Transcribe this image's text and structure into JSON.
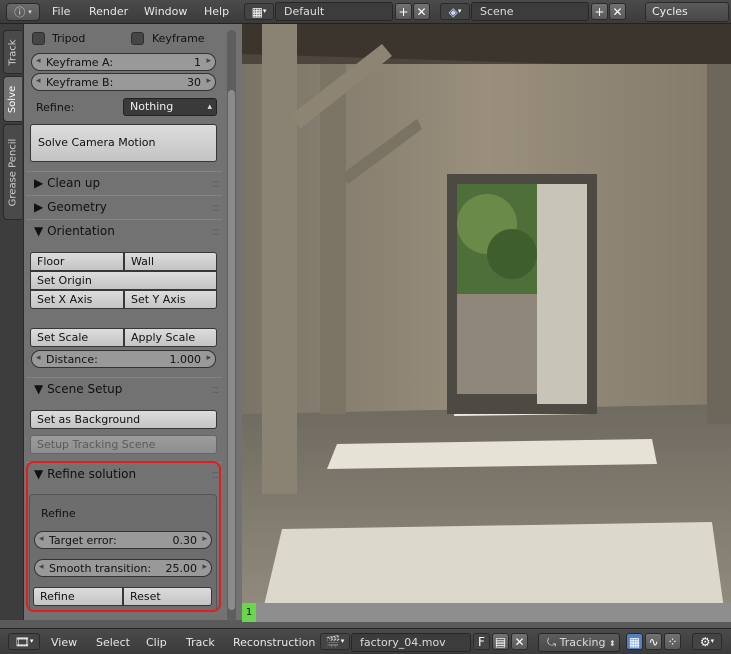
{
  "header": {
    "menus": [
      "File",
      "Render",
      "Window",
      "Help"
    ],
    "screen_layout": "Default",
    "scene": "Scene",
    "render_engine": "Cycles Render"
  },
  "side_tabs": [
    "Track",
    "Solve",
    "Grease Pencil"
  ],
  "solve": {
    "tripod_label": "Tripod",
    "keyframe_label": "Keyframe",
    "keyframe_a_label": "Keyframe A:",
    "keyframe_a_value": "1",
    "keyframe_b_label": "Keyframe B:",
    "keyframe_b_value": "30",
    "refine_label": "Refine:",
    "refine_value": "Nothing",
    "solve_button": "Solve Camera Motion"
  },
  "panels": {
    "clean_up": "Clean up",
    "geometry": "Geometry",
    "orientation": "Orientation",
    "scene_setup": "Scene Setup",
    "refine_solution": "Refine solution"
  },
  "orientation": {
    "floor": "Floor",
    "wall": "Wall",
    "set_origin": "Set Origin",
    "set_x_axis": "Set X Axis",
    "set_y_axis": "Set Y Axis",
    "set_scale": "Set Scale",
    "apply_scale": "Apply Scale",
    "distance_label": "Distance:",
    "distance_value": "1.000"
  },
  "scene_setup": {
    "set_as_background": "Set as Background",
    "setup_tracking_scene": "Setup Tracking Scene"
  },
  "refine_solution": {
    "refine_title": "Refine",
    "target_error_label": "Target error:",
    "target_error_value": "0.30",
    "smooth_transition_label": "Smooth transition:",
    "smooth_transition_value": "25.00",
    "refine_button": "Refine",
    "reset_button": "Reset"
  },
  "timeline": {
    "current_frame": "1"
  },
  "footer": {
    "menus": [
      "View",
      "Select",
      "Clip",
      "Track",
      "Reconstruction"
    ],
    "clip_name": "factory_04.mov",
    "fake_user": "F",
    "mode": "Tracking"
  },
  "colors": {
    "highlight": "#e21d1d",
    "frame_marker": "#69d64b",
    "panel_bg": "#727272"
  }
}
